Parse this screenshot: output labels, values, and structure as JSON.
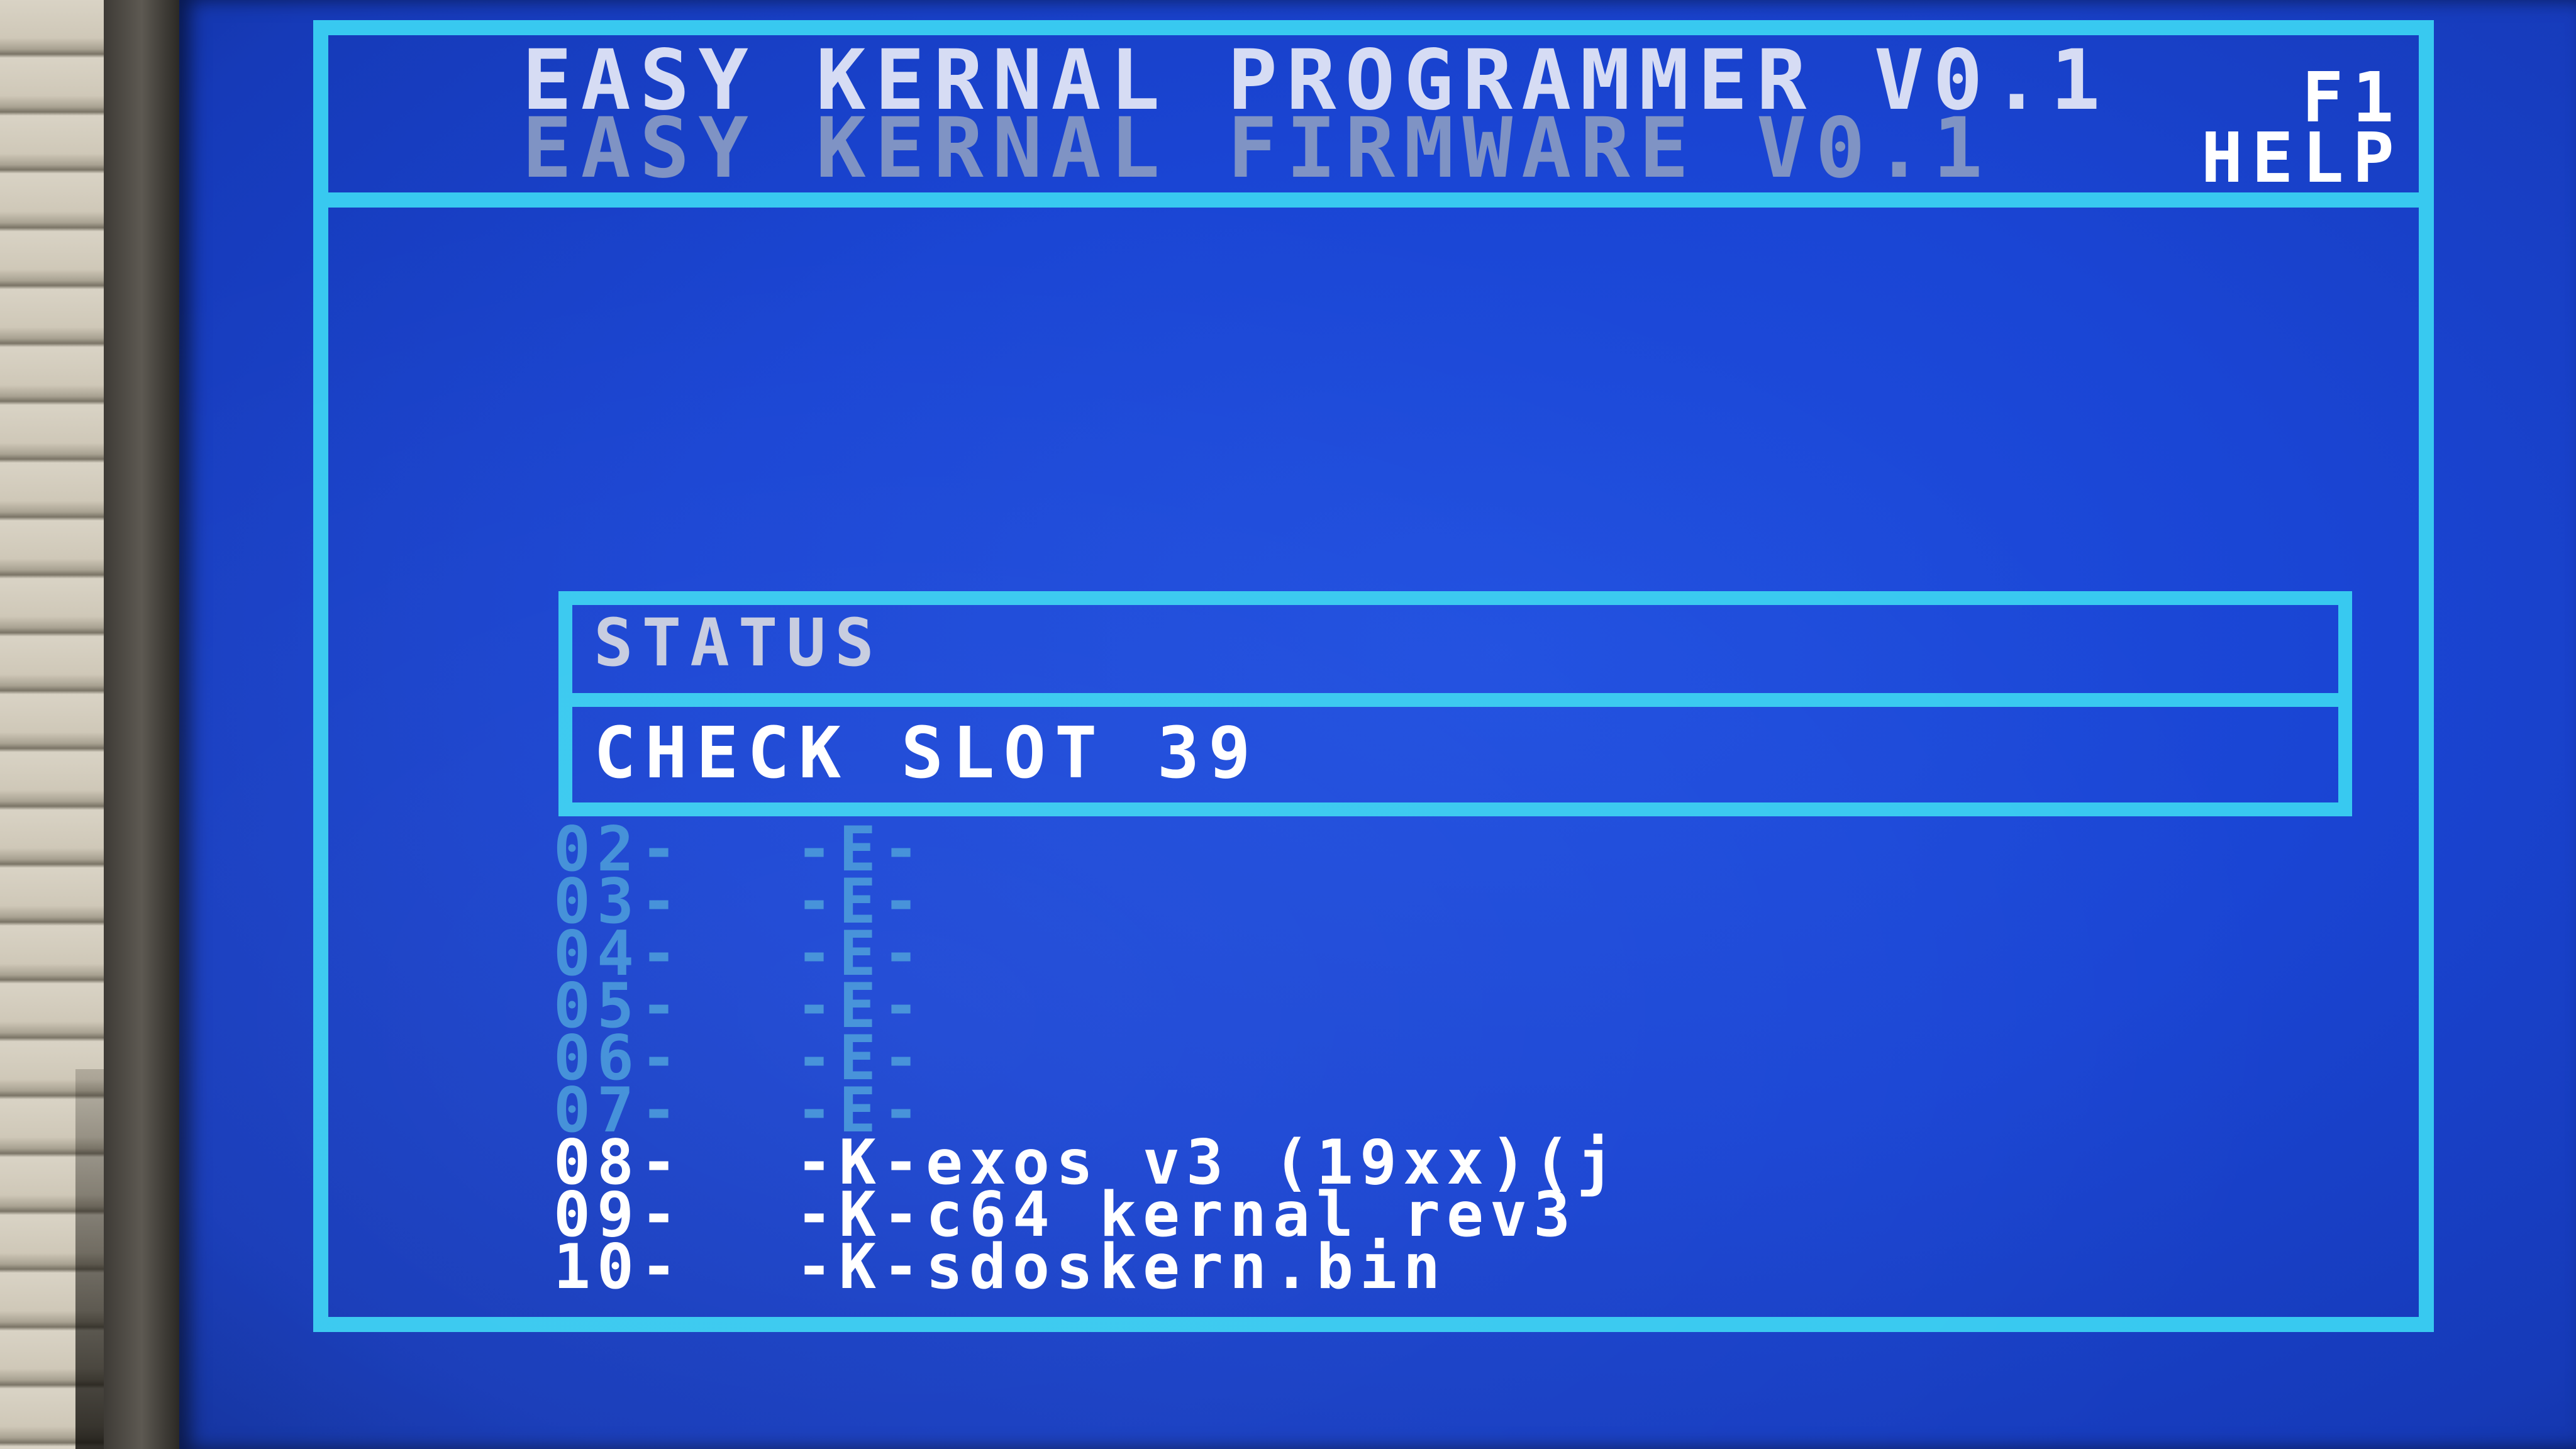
{
  "colors": {
    "screen_background": "#1a45d4",
    "frame_cyan": "#38c9f0",
    "text_white": "#ffffff",
    "text_light": "#d6dcf4",
    "text_dim": "#7f93c4",
    "empty_slot": "#3f8ed8"
  },
  "header": {
    "title_line1": "EASY KERNAL PROGRAMMER V0.1",
    "title_line2": "EASY KERNAL FIRMWARE V0.1",
    "help_key": "F1",
    "help_label": "HELP"
  },
  "status": {
    "title": "STATUS",
    "message": "CHECK SLOT 39"
  },
  "slots": [
    {
      "number": "02-",
      "entry": "-E-"
    },
    {
      "number": "03-",
      "entry": "-E-"
    },
    {
      "number": "04-",
      "entry": "-E-"
    },
    {
      "number": "05-",
      "entry": "-E-"
    },
    {
      "number": "06-",
      "entry": "-E-"
    },
    {
      "number": "07-",
      "entry": "-E-"
    },
    {
      "number": "08-",
      "entry": "-K-exos v3 (19xx)(j"
    },
    {
      "number": "09-",
      "entry": "-K-c64 kernal rev3"
    },
    {
      "number": "10-",
      "entry": "-K-sdoskern.bin"
    }
  ]
}
